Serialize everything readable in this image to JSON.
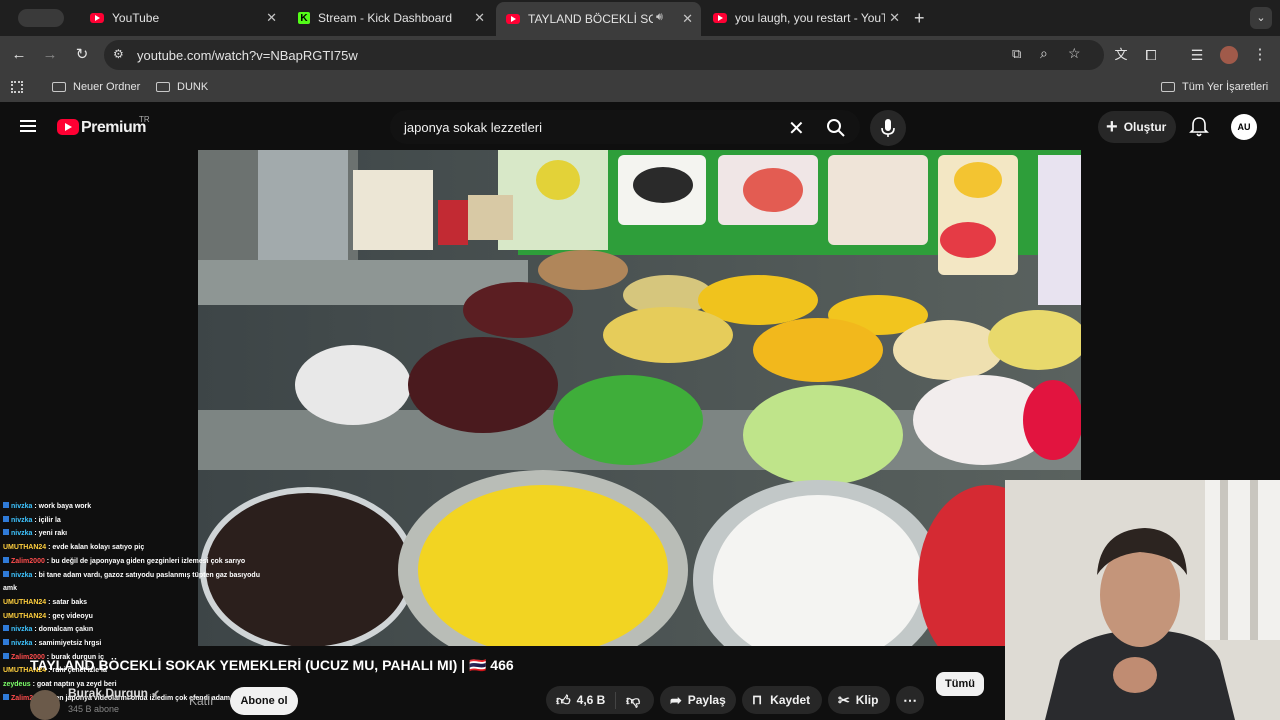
{
  "browser": {
    "tabs": [
      {
        "title": "YouTube",
        "favicon": "youtube-icon"
      },
      {
        "title": "Stream - Kick Dashboard",
        "favicon": "kick-icon"
      },
      {
        "title": "TAYLAND BÖCEKLİ SOKA",
        "favicon": "youtube-icon",
        "active": true,
        "audio": true
      },
      {
        "title": "you laugh, you restart - YouTu",
        "favicon": "youtube-icon"
      }
    ],
    "url": "youtube.com/watch?v=NBapRGTI75w",
    "bookmarks": [
      {
        "label": "Neuer Ordner"
      },
      {
        "label": "DUNK"
      }
    ],
    "all_bookmarks": "Tüm Yer İşaretleri"
  },
  "youtube": {
    "logo_text": "Premium",
    "country": "TR",
    "search_query": "japonya sokak lezzetleri",
    "create_label": "Oluştur",
    "avatar_text": "AU"
  },
  "chat": [
    {
      "user": "nivzka",
      "text": "work baya work",
      "color": "blue",
      "badge": true
    },
    {
      "user": "nivzka",
      "text": "içilir la",
      "color": "blue",
      "badge": true
    },
    {
      "user": "nivzka",
      "text": "yeni rakı",
      "color": "blue",
      "badge": true
    },
    {
      "user": "UMUTHAN24",
      "text": "evde kalan kolayı satıyo piç",
      "color": "gold",
      "badge": false
    },
    {
      "user": "Zalim2000",
      "text": "bu değil de japonyaya giden gezginleri izlemesi çok sarıyo",
      "color": "red",
      "badge": true
    },
    {
      "user": "nivzka",
      "text": "bi tane adam vardı, gazoz satıyodu paslanmış tüpten gaz basıyodu amk",
      "color": "blue",
      "badge": true
    },
    {
      "user": "UMUTHAN24",
      "text": "satar baks",
      "color": "gold",
      "badge": false
    },
    {
      "user": "UMUTHAN24",
      "text": "geç videoyu",
      "color": "gold",
      "badge": false
    },
    {
      "user": "nivzka",
      "text": "domalcam çakın",
      "color": "blue",
      "badge": true
    },
    {
      "user": "nivzka",
      "text": "samimiyetsiz hrgsi",
      "color": "blue",
      "badge": true
    },
    {
      "user": "Zalim2000",
      "text": "burak durgun iç",
      "color": "red",
      "badge": true
    },
    {
      "user": "UMUTHAN24",
      "text": "ruhi çenet izle la",
      "color": "gold",
      "badge": false
    },
    {
      "user": "zeydeus",
      "text": "goat naptın ya zeyd beri",
      "color": "green",
      "badge": false
    },
    {
      "user": "Zalim2000",
      "text": "ben japonya videolarını onda izledim çok efendi adam",
      "color": "red",
      "badge": true
    }
  ],
  "video": {
    "title": "TAYLAND BÖCEKLİ SOKAK YEMEKLERİ (UCUZ MU, PAHALI MI) | 🇹🇭 466",
    "channel": "Burak Durgun",
    "subscribers": "345 B abone",
    "join_label": "Katıl",
    "subscribe_label": "Abone ol",
    "likes": "4,6 B",
    "share_label": "Paylaş",
    "save_label": "Kaydet",
    "clip_label": "Klip",
    "filter_all": "Tümü"
  },
  "colors": {
    "youtube_red": "#ff0033",
    "kick_green": "#53fc18",
    "browser_dark": "#1f1f1f"
  }
}
